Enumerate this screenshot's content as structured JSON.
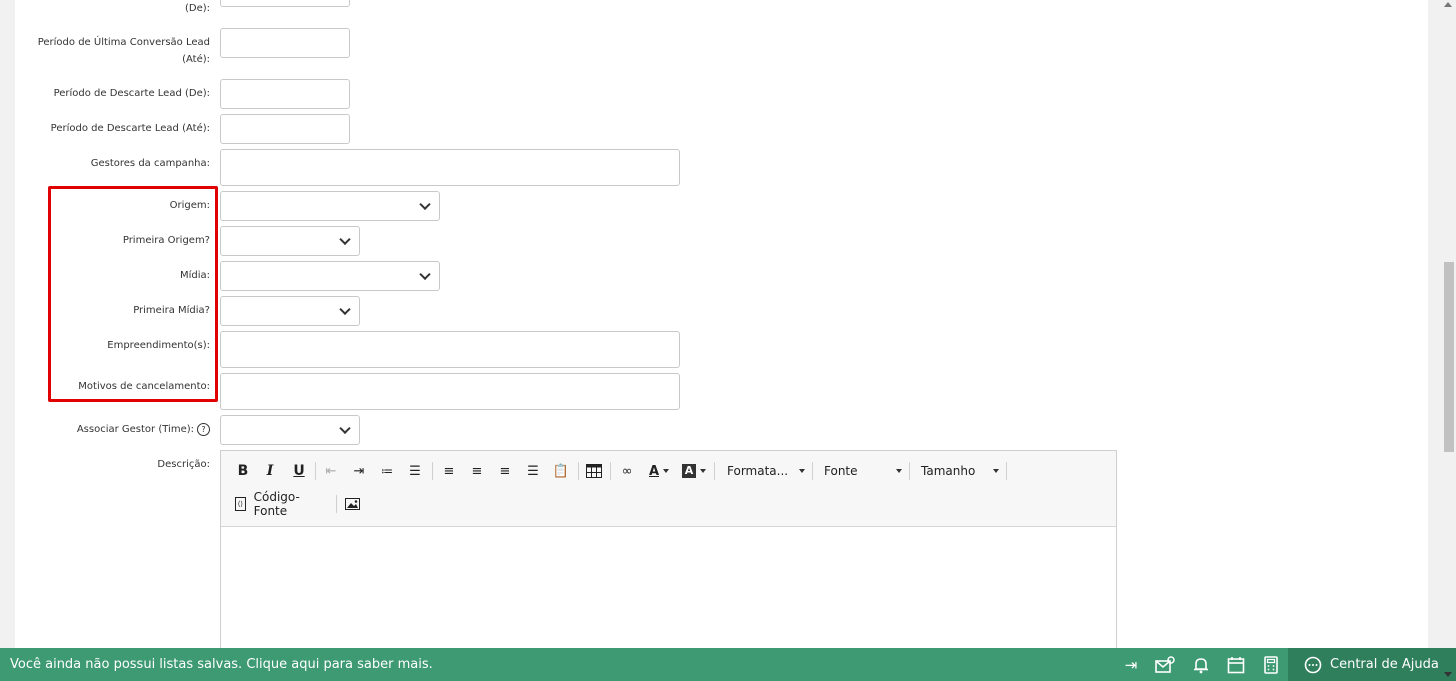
{
  "form": {
    "fields": [
      {
        "label": "(De):"
      },
      {
        "label": "Período de Última Conversão Lead"
      },
      {
        "label": "(Até):"
      },
      {
        "label": "Período de Descarte Lead (De):"
      },
      {
        "label": "Período de Descarte Lead (Até):"
      },
      {
        "label": "Gestores da campanha:"
      },
      {
        "label": "Origem:"
      },
      {
        "label": "Primeira Origem?"
      },
      {
        "label": "Mídia:"
      },
      {
        "label": "Primeira Mídia?"
      },
      {
        "label": "Empreendimento(s):"
      },
      {
        "label": "Motivos de cancelamento:"
      },
      {
        "label": "Associar Gestor (Time):"
      },
      {
        "label": "Descrição:"
      }
    ],
    "help_glyph": "?"
  },
  "editor": {
    "format_label": "Formata...",
    "font_label": "Fonte",
    "size_label": "Tamanho",
    "source_label": "Código-Fonte",
    "icons": [
      "bold-icon",
      "italic-icon",
      "underline-icon",
      "outdent-icon",
      "indent-icon",
      "numbered-list-icon",
      "bullet-list-icon",
      "align-left-icon",
      "align-center-icon",
      "align-right-icon",
      "justify-icon",
      "paste-icon",
      "table-icon",
      "link-icon",
      "text-color-icon",
      "background-color-icon",
      "source-code-icon",
      "image-icon"
    ]
  },
  "bottom_bar": {
    "message": "Você ainda não possui listas salvas. Clique aqui para saber mais.",
    "help_label": "Central de Ajuda",
    "color": "#3d9a73"
  }
}
